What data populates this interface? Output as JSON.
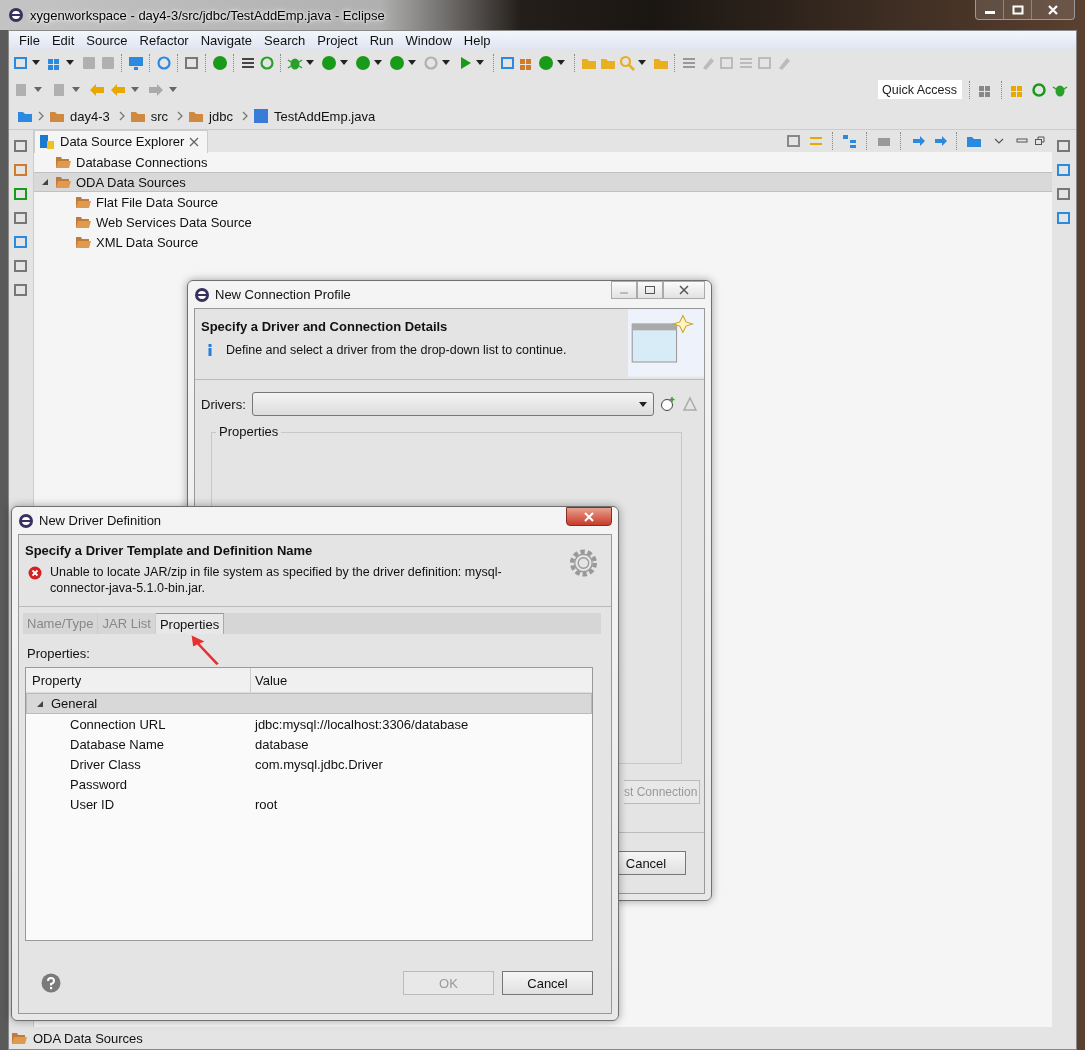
{
  "window": {
    "title": "xygenworkspace - day4-3/src/jdbc/TestAddEmp.java - Eclipse"
  },
  "menu": [
    "File",
    "Edit",
    "Source",
    "Refactor",
    "Navigate",
    "Search",
    "Project",
    "Run",
    "Window",
    "Help"
  ],
  "breadcrumb": [
    "day4-3",
    "src",
    "jdbc",
    "TestAddEmp.java"
  ],
  "quick_access": {
    "placeholder": "Quick Access"
  },
  "view": {
    "tab": "Data Source Explorer",
    "tree": [
      {
        "label": "Database Connections",
        "selected": false
      },
      {
        "label": "ODA Data Sources",
        "selected": true,
        "expanded": true,
        "children": [
          {
            "label": "Flat File Data Source",
            "selected": false
          },
          {
            "label": "Web Services Data Source",
            "selected": false
          },
          {
            "label": "XML Data Source",
            "selected": false
          }
        ]
      }
    ]
  },
  "status_bar": "ODA Data Sources",
  "connection_dialog": {
    "title": "New Connection Profile",
    "heading": "Specify a Driver and Connection Details",
    "message": "Define and select a driver from the drop-down list to continue.",
    "drivers_label": "Drivers:",
    "group": "Properties",
    "test_button": "st Connection",
    "cancel": "Cancel"
  },
  "driver_dialog": {
    "title": "New Driver Definition",
    "heading": "Specify a Driver Template and Definition Name",
    "error": "Unable to locate JAR/zip in file system as specified by the driver definition: mysql-connector-java-5.1.0-bin.jar.",
    "tabs": [
      {
        "label": "Name/Type",
        "selected": false
      },
      {
        "label": "JAR List",
        "selected": false
      },
      {
        "label": "Properties",
        "selected": true
      }
    ],
    "properties_label": "Properties:",
    "columns": [
      "Property",
      "Value"
    ],
    "group": {
      "label": "General",
      "expanded": true,
      "rows": [
        {
          "property": "Connection URL",
          "value": "jdbc:mysql://localhost:3306/database"
        },
        {
          "property": "Database Name",
          "value": "database"
        },
        {
          "property": "Driver Class",
          "value": "com.mysql.jdbc.Driver"
        },
        {
          "property": "Password",
          "value": ""
        },
        {
          "property": "User ID",
          "value": "root"
        }
      ]
    },
    "buttons": [
      {
        "label": "OK",
        "disabled": true
      },
      {
        "label": "Cancel",
        "disabled": false
      }
    ]
  }
}
